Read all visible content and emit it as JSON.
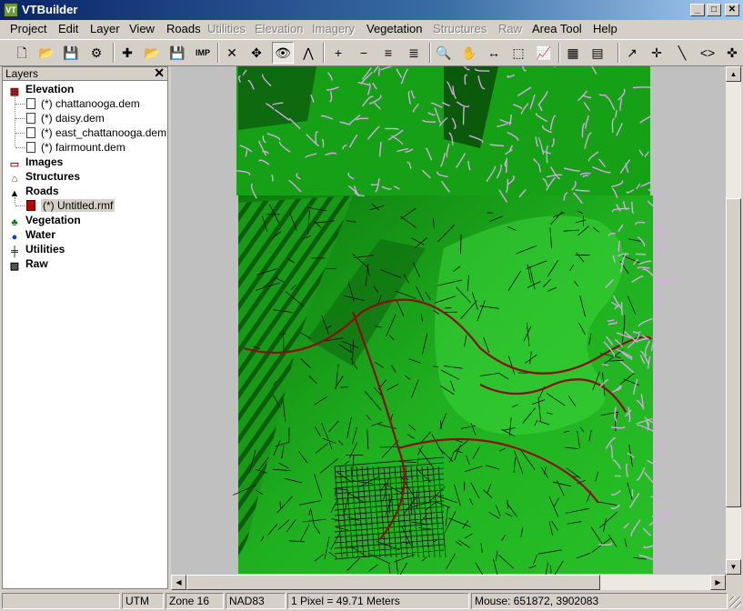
{
  "window": {
    "title": "VTBuilder",
    "app_icon": "vt-icon",
    "min": "_",
    "max": "□",
    "close": "✕"
  },
  "menu": [
    {
      "label": "Project",
      "enabled": true
    },
    {
      "label": "Edit",
      "enabled": true
    },
    {
      "label": "Layer",
      "enabled": true
    },
    {
      "label": "View",
      "enabled": true
    },
    {
      "label": "Roads",
      "enabled": true
    },
    {
      "label": "Utilities",
      "enabled": false
    },
    {
      "label": "Elevation",
      "enabled": false
    },
    {
      "label": "Imagery",
      "enabled": false
    },
    {
      "label": "Vegetation",
      "enabled": true
    },
    {
      "label": "Structures",
      "enabled": false
    },
    {
      "label": "Raw",
      "enabled": false
    },
    {
      "label": "Area Tool",
      "enabled": true
    },
    {
      "label": "Help",
      "enabled": true
    }
  ],
  "toolbar": [
    {
      "name": "new-project-button",
      "glyph": "🗋"
    },
    {
      "name": "open-project-button",
      "glyph": "📂"
    },
    {
      "name": "save-project-button",
      "glyph": "💾"
    },
    {
      "name": "generate-button",
      "glyph": "⚙"
    },
    {
      "name": "new-layer-button",
      "glyph": "✚"
    },
    {
      "name": "load-layer-button",
      "glyph": "📂"
    },
    {
      "name": "save-layer-button",
      "glyph": "💾"
    },
    {
      "name": "import-button",
      "glyph": "IMP"
    },
    {
      "name": "delete-button",
      "glyph": "✕"
    },
    {
      "name": "move-button",
      "glyph": "✥"
    },
    {
      "name": "toggle-visibility-button",
      "glyph": "👁"
    },
    {
      "name": "elevation-button",
      "glyph": "⋀"
    },
    {
      "name": "zoom-in-button",
      "glyph": "+"
    },
    {
      "name": "zoom-out-button",
      "glyph": "−"
    },
    {
      "name": "zoom-all-button",
      "glyph": "≡"
    },
    {
      "name": "zoom-layer-button",
      "glyph": "≣"
    },
    {
      "name": "magnify-button",
      "glyph": "🔍"
    },
    {
      "name": "pan-button",
      "glyph": "✋"
    },
    {
      "name": "distance-button",
      "glyph": "↔"
    },
    {
      "name": "select-area-button",
      "glyph": "⬚"
    },
    {
      "name": "profile-button",
      "glyph": "📈"
    },
    {
      "name": "map-offset-button",
      "glyph": "▦"
    },
    {
      "name": "grid-button",
      "glyph": "▤"
    },
    {
      "name": "road-select-button",
      "glyph": "↗"
    },
    {
      "name": "road-edit-button",
      "glyph": "✛"
    },
    {
      "name": "road-draw-button",
      "glyph": "╲"
    },
    {
      "name": "road-connect-button",
      "glyph": "<>"
    },
    {
      "name": "road-split-button",
      "glyph": "✜"
    }
  ],
  "layers_panel": {
    "title": "Layers",
    "close": "✕",
    "tree": [
      {
        "label": "Elevation",
        "type": "category",
        "icon": "elevation-icon",
        "icon_color": "#800000",
        "children": [
          "(*) chattanooga.dem",
          "(*) daisy.dem",
          "(*) east_chattanooga.dem",
          "(*) fairmount.dem"
        ]
      },
      {
        "label": "Images",
        "type": "category",
        "icon": "images-icon",
        "icon_color": "#a02020",
        "children": []
      },
      {
        "label": "Structures",
        "type": "category",
        "icon": "structures-icon",
        "icon_color": "#6a3a1a",
        "children": []
      },
      {
        "label": "Roads",
        "type": "category",
        "icon": "roads-icon",
        "icon_color": "#000000",
        "children": [
          "(*) Untitled.rmf"
        ]
      },
      {
        "label": "Vegetation",
        "type": "category",
        "icon": "vegetation-icon",
        "icon_color": "#007a00",
        "children": []
      },
      {
        "label": "Water",
        "type": "category",
        "icon": "water-icon",
        "icon_color": "#0044cc",
        "children": []
      },
      {
        "label": "Utilities",
        "type": "category",
        "icon": "utilities-icon",
        "icon_color": "#000000",
        "children": []
      },
      {
        "label": "Raw",
        "type": "category",
        "icon": "raw-icon",
        "icon_color": "#000000",
        "children": []
      }
    ],
    "selected": "(*) Untitled.rmf"
  },
  "map": {
    "terrain_color": "#1aa31a",
    "road_color": "#101010",
    "highway_color": "#8a1010",
    "border_road_color": "#d8a8e8"
  },
  "status": {
    "projection": "UTM",
    "zone": "Zone 16",
    "datum": "NAD83",
    "scale": "1 Pixel = 49.71 Meters",
    "mouse": "Mouse: 651872, 3902083"
  }
}
